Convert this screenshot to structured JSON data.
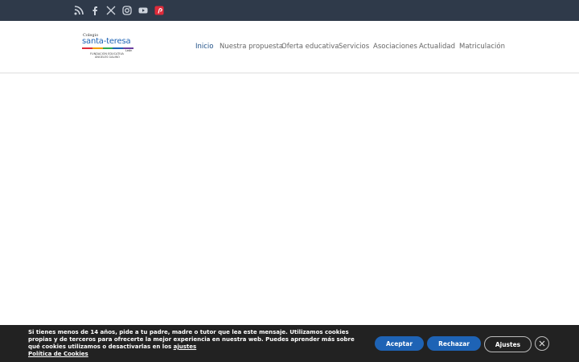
{
  "topbar": {
    "icons": [
      "rss-icon",
      "facebook-icon",
      "x-twitter-icon",
      "instagram-icon",
      "youtube-icon",
      "pinterest-icon"
    ],
    "accent": "#e02b3a"
  },
  "logo": {
    "line1": "Colegio",
    "line2": "santa-teresa",
    "line3": "León",
    "line4": "FUNDACIÓN EDUCATIVA",
    "line5": "ÁNGELES GALINO",
    "bar_colors": [
      "#e02b3a",
      "#f29f05",
      "#2fa84f",
      "#1e63b5",
      "#6b3fa0"
    ]
  },
  "nav": {
    "items": [
      "Inicio",
      "Nuestra propuesta",
      "Oferta educativa",
      "Servicios",
      "Asociaciones",
      "Actualidad",
      "Matriculación"
    ],
    "active_color": "#1e4f86"
  },
  "cookie": {
    "text": "Si tienes menos de 14 años, pide a tu padre, madre o tutor que lea este mensaje. Utilizamos cookies propias y de terceros para ofrecerte la mejor experiencia en nuestra web. Puedes aprender más sobre qué cookies utilizamos o desactivarlas en los",
    "link_settings": "ajustes",
    "link_policy": "Política de Cookies",
    "accept": "Aceptar",
    "reject": "Rechazar",
    "settings": "Ajustes"
  }
}
